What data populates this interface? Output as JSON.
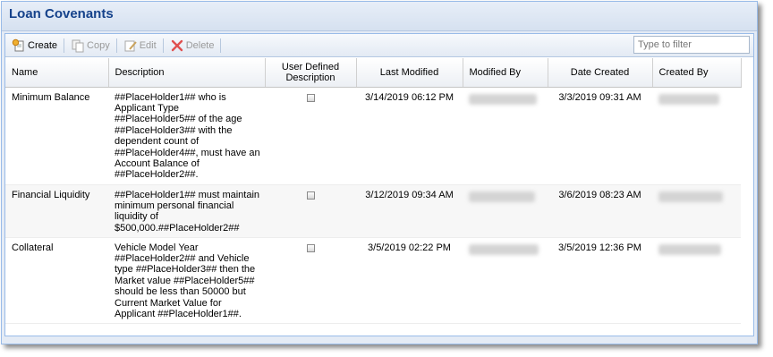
{
  "panel": {
    "title": "Loan Covenants"
  },
  "toolbar": {
    "create_label": "Create",
    "copy_label": "Copy",
    "edit_label": "Edit",
    "delete_label": "Delete",
    "filter_placeholder": "Type to filter",
    "filter_value": ""
  },
  "columns": {
    "name": "Name",
    "description": "Description",
    "user_defined": "User Defined\nDescription",
    "last_modified": "Last Modified",
    "modified_by": "Modified By",
    "date_created": "Date Created",
    "created_by": "Created By"
  },
  "rows": [
    {
      "name": "Minimum Balance",
      "description": "##PlaceHolder1## who is Applicant Type ##PlaceHolder5## of the age ##PlaceHolder3## with the dependent count of ##PlaceHolder4##, must have an Account Balance of ##PlaceHolder2##.",
      "user_defined": false,
      "last_modified": "3/14/2019 06:12 PM",
      "date_created": "3/3/2019 09:31 AM"
    },
    {
      "name": "Financial Liquidity",
      "description": "##PlaceHolder1## must maintain minimum personal financial liquidity of $500,000.##PlaceHolder2##",
      "user_defined": false,
      "last_modified": "3/12/2019 09:34 AM",
      "date_created": "3/6/2019 08:23 AM"
    },
    {
      "name": "Collateral",
      "description": "Vehicle Model Year ##PlaceHolder2## and Vehicle type ##PlaceHolder3## then the Market value ##PlaceHolder5## should be less than 50000 but Current Market Value for Applicant ##PlaceHolder1##.",
      "user_defined": false,
      "last_modified": "3/5/2019 02:22 PM",
      "date_created": "3/5/2019 12:36 PM"
    }
  ],
  "colors": {
    "title": "#15428b",
    "border": "#99bbe8",
    "delete_icon": "#e05050"
  },
  "icons": [
    "create-icon",
    "copy-icon",
    "edit-icon",
    "delete-icon",
    "checkbox-icon"
  ]
}
